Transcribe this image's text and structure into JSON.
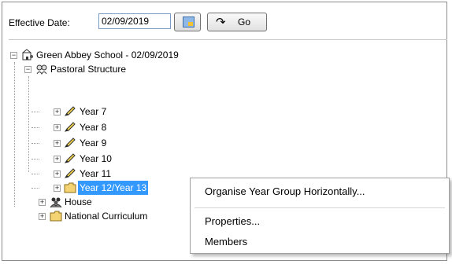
{
  "toolbar": {
    "effective_date_label": "Effective Date:",
    "effective_date_value": "02/09/2019",
    "calendar_icon": "calendar-icon",
    "go_icon": "redo-arrow-icon",
    "go_label": "Go"
  },
  "tree": {
    "root": {
      "label": "Green Abbey School - 02/09/2019",
      "icon": "school-icon"
    },
    "pastoral": {
      "label": "Pastoral Structure",
      "icon": "structure-icon"
    },
    "years": [
      {
        "label": "Year  7",
        "icon": "pencil-icon"
      },
      {
        "label": "Year  8",
        "icon": "pencil-icon"
      },
      {
        "label": "Year  9",
        "icon": "pencil-icon"
      },
      {
        "label": "Year 10",
        "icon": "pencil-icon"
      },
      {
        "label": "Year 11",
        "icon": "pencil-icon"
      },
      {
        "label": "Year 12/Year 13",
        "icon": "folder-icon",
        "selected": true
      }
    ],
    "house": {
      "label": "House",
      "icon": "house-group-icon"
    },
    "national_curriculum": {
      "label": "National Curriculum",
      "icon": "folder-icon"
    }
  },
  "context_menu": {
    "items": [
      {
        "label": "Organise Year Group Horizontally..."
      },
      {
        "label": "Properties..."
      },
      {
        "label": "Members"
      }
    ]
  },
  "colors": {
    "selection": "#3399ff",
    "pencil_body": "#f3d34a",
    "folder": "#f4d472"
  }
}
